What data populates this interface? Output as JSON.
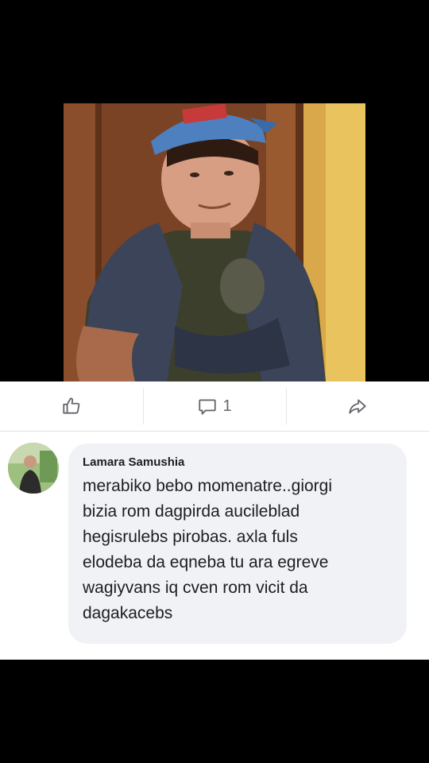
{
  "post": {
    "actions": [
      {
        "id": "like",
        "icon": "thumbs-up-icon",
        "count": ""
      },
      {
        "id": "comment",
        "icon": "comment-bubble-icon",
        "count": "1"
      },
      {
        "id": "share",
        "icon": "share-arrow-icon",
        "count": ""
      }
    ]
  },
  "comment": {
    "author": "Lamara Samushia",
    "lines": [
      "merabiko bebo momenatre..giorgi",
      "bizia rom dagpirda aucileblad",
      "hegisrulebs pirobas. axla fuls",
      "elodeba da eqneba tu ara egreve",
      "wagiyvans iq cven rom vicit da",
      "dagakacebs"
    ]
  },
  "colors": {
    "icon": "#65676b",
    "bubble": "#f0f2f5",
    "text": "#1c1e21"
  }
}
